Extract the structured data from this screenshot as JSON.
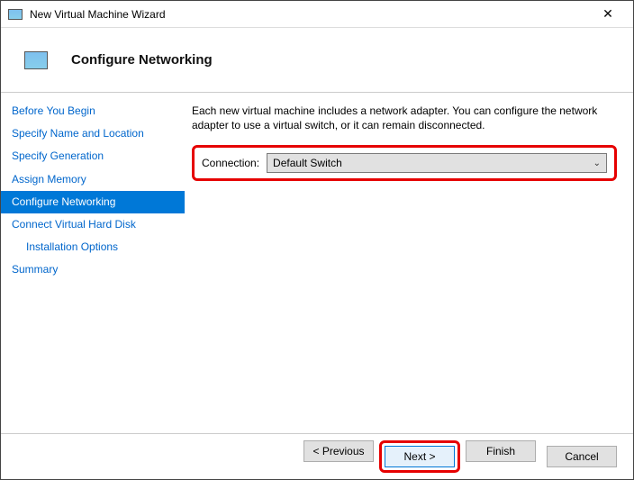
{
  "window": {
    "title": "New Virtual Machine Wizard"
  },
  "header": {
    "title": "Configure Networking"
  },
  "sidebar": {
    "items": [
      {
        "label": "Before You Begin",
        "selected": false,
        "indent": false
      },
      {
        "label": "Specify Name and Location",
        "selected": false,
        "indent": false
      },
      {
        "label": "Specify Generation",
        "selected": false,
        "indent": false
      },
      {
        "label": "Assign Memory",
        "selected": false,
        "indent": false
      },
      {
        "label": "Configure Networking",
        "selected": true,
        "indent": false
      },
      {
        "label": "Connect Virtual Hard Disk",
        "selected": false,
        "indent": false
      },
      {
        "label": "Installation Options",
        "selected": false,
        "indent": true
      },
      {
        "label": "Summary",
        "selected": false,
        "indent": false
      }
    ]
  },
  "main": {
    "description": "Each new virtual machine includes a network adapter. You can configure the network adapter to use a virtual switch, or it can remain disconnected.",
    "connection_label": "Connection:",
    "connection_value": "Default Switch"
  },
  "footer": {
    "previous": "< Previous",
    "next": "Next >",
    "finish": "Finish",
    "cancel": "Cancel"
  }
}
